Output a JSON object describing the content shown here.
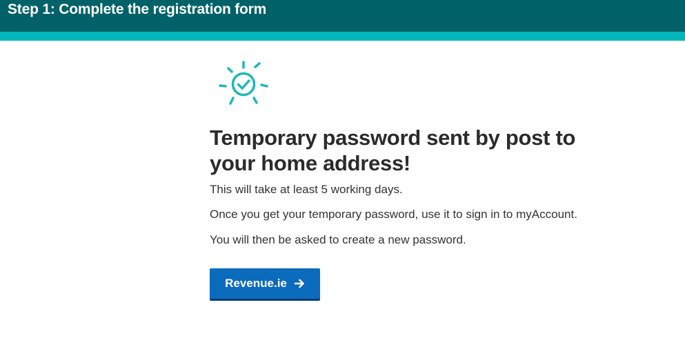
{
  "header": {
    "title": "Step 1: Complete the registration form",
    "background_color": "#006268",
    "accent_color": "#00b7bc"
  },
  "confirmation": {
    "icon": "sun-check-icon",
    "icon_color": "#1fb7b8",
    "heading": "Temporary password sent by post to your home address!",
    "paragraphs": [
      "This will take at least 5 working days.",
      "Once you get your temporary password, use it to sign in to myAccount.",
      "You will then be asked to create a new password."
    ]
  },
  "cta": {
    "label": "Revenue.ie",
    "icon": "arrow-right-icon",
    "color": "#0b6bbd"
  }
}
